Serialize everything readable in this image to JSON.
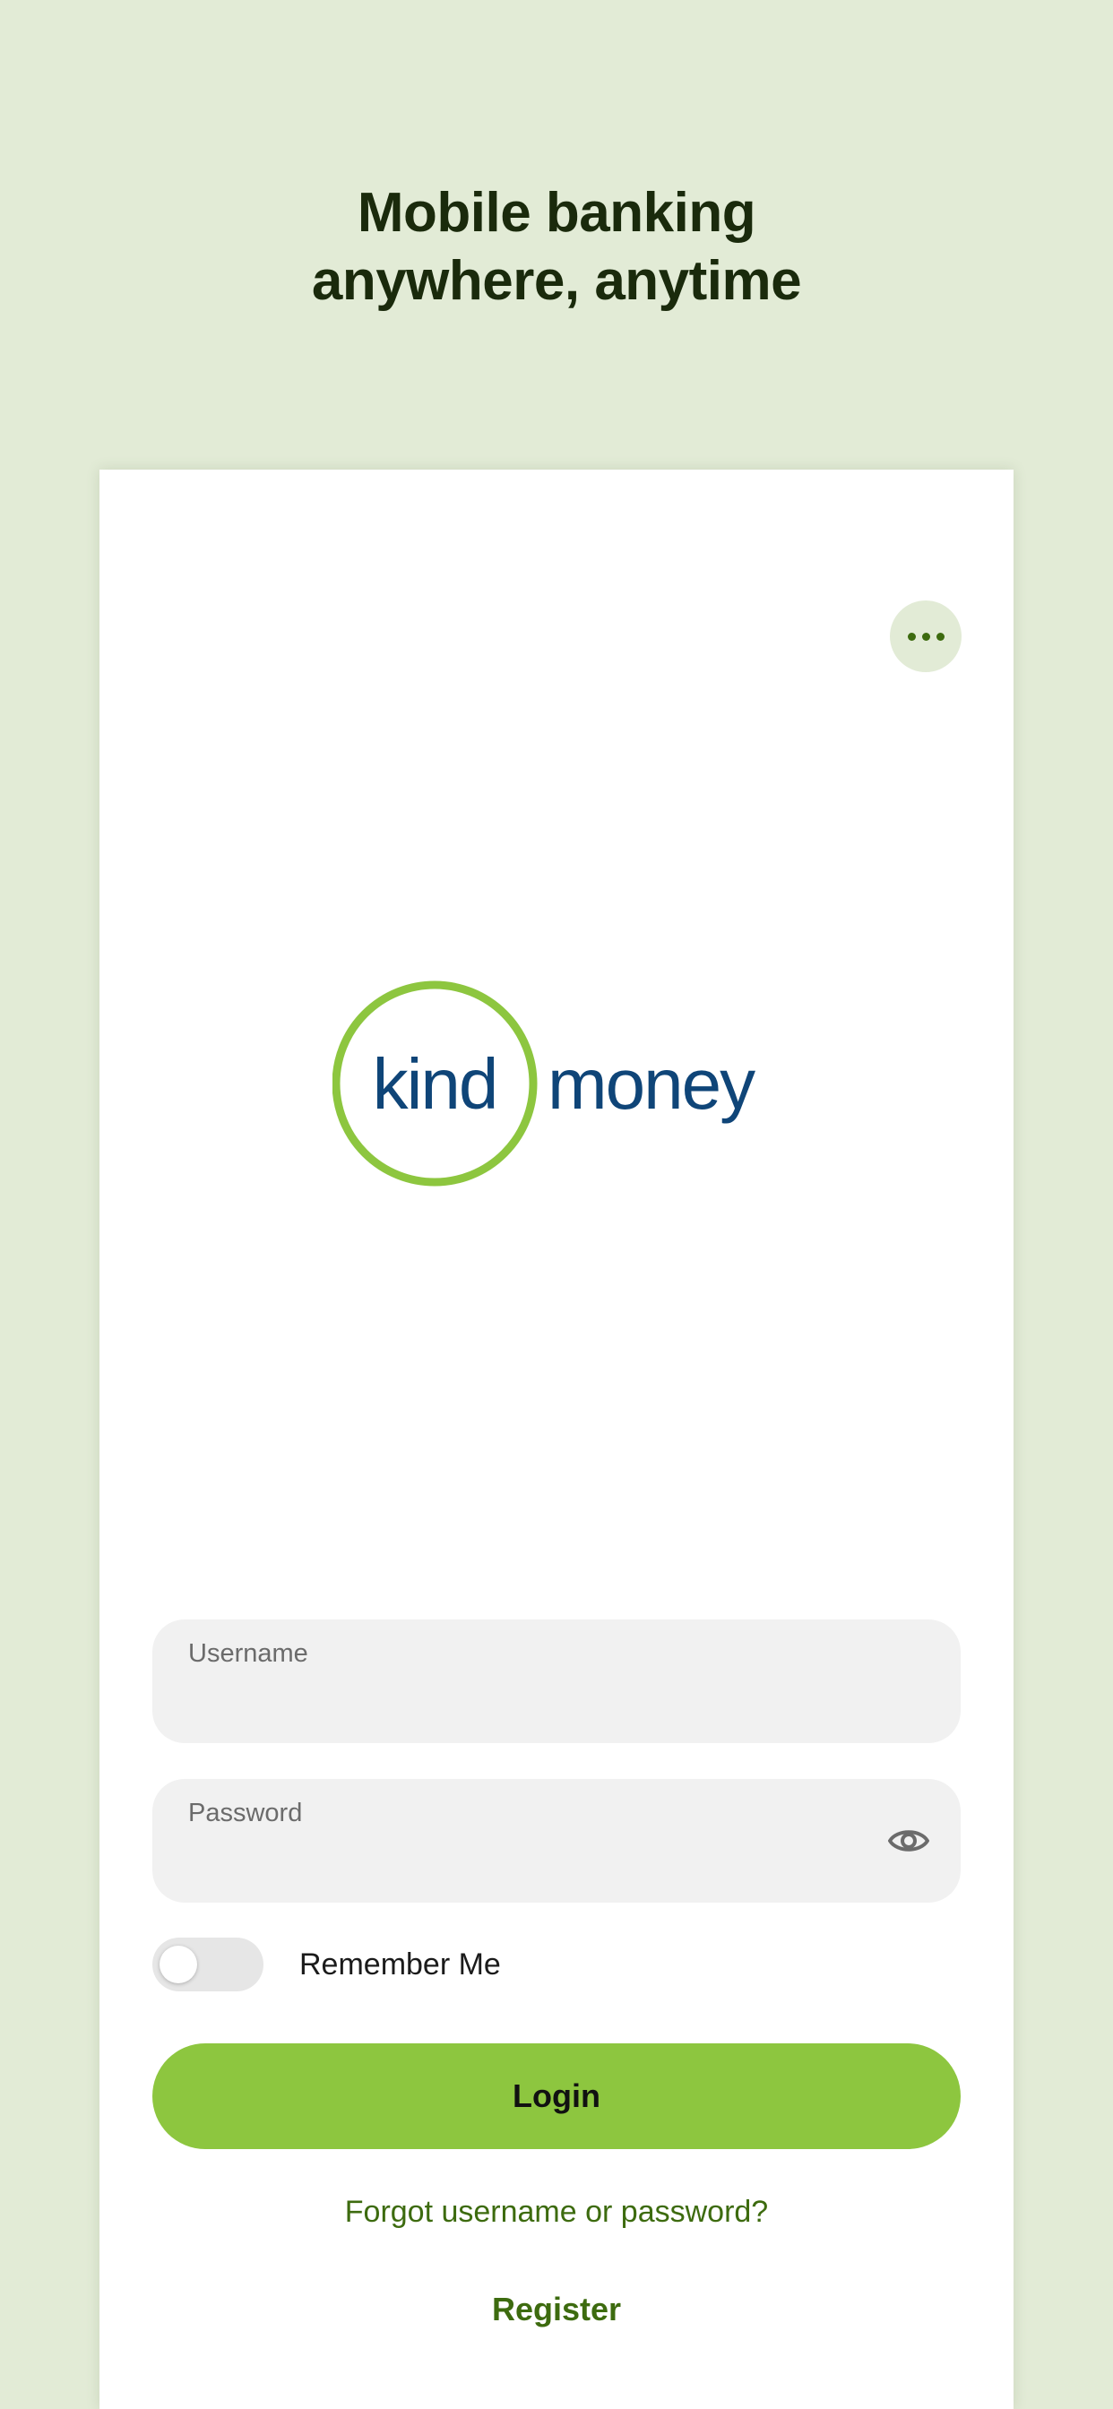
{
  "headline": {
    "line1": "Mobile banking",
    "line2": "anywhere, anytime"
  },
  "header": {
    "more_icon": "more-horizontal-icon"
  },
  "logo": {
    "word1": "kind",
    "word2": "money",
    "colors": {
      "ring": "#8dc63f",
      "text": "#0f4578"
    }
  },
  "form": {
    "username": {
      "label": "Username",
      "value": ""
    },
    "password": {
      "label": "Password",
      "value": "",
      "toggle_icon": "eye-icon"
    },
    "remember_me": {
      "label": "Remember Me",
      "checked": false
    },
    "login_label": "Login",
    "forgot_label": "Forgot username or password?",
    "register_label": "Register"
  },
  "colors": {
    "background": "#e2ebd6",
    "accent": "#8dc63f",
    "link": "#3d6b0f"
  }
}
